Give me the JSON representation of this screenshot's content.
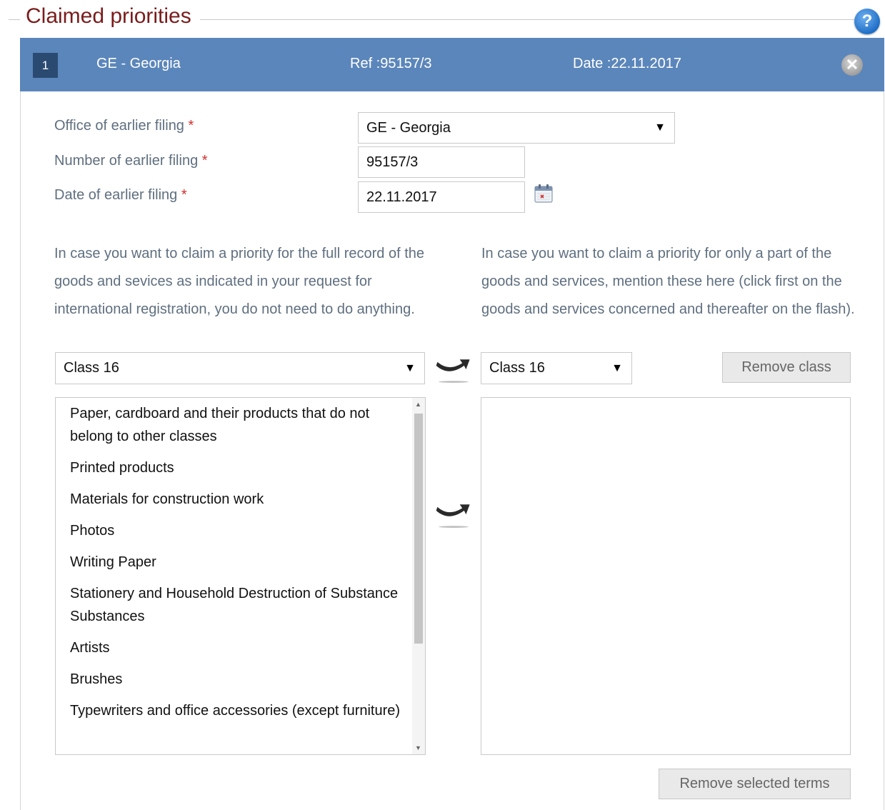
{
  "fieldset": {
    "title": "Claimed priorities",
    "help_glyph": "?"
  },
  "priority_bar": {
    "index": "1",
    "country": "GE - Georgia",
    "ref": "Ref :95157/3",
    "date": "Date :22.11.2017",
    "close_glyph": "✕"
  },
  "form": {
    "office_label": "Office of earlier filing",
    "office_value": "GE - Georgia",
    "number_label": "Number of earlier filing",
    "number_value": "95157/3",
    "date_label": "Date of earlier filing",
    "date_value": "22.11.2017",
    "required_mark": "*"
  },
  "instructions": {
    "left": "In case you want to claim a priority for the full record of the goods and sevices as indicated in your request for international registration, you do not need to do anything.",
    "right": "In case you want to claim a priority for only a part of the goods and services, mention these here (click first on the goods and services concerned and thereafter on the flash)."
  },
  "classes": {
    "left_select": "Class 16",
    "right_select": "Class 16",
    "remove_class": "Remove class",
    "remove_terms": "Remove selected terms",
    "dropdown_glyph": "▼"
  },
  "terms": [
    "Paper, cardboard and their products that do not belong to other classes",
    "Printed products",
    "Materials for construction work",
    "Photos",
    "Writing Paper",
    "Stationery and Household Destruction of Substance Substances",
    "Artists",
    "Brushes",
    "Typewriters and office accessories (except furniture)"
  ],
  "colors": {
    "title": "#7a1c1c",
    "bar": "#5b86bb",
    "bar_index": "#2b4a72",
    "label": "#5f6f7f",
    "required": "#d0302e"
  },
  "icons": {
    "help": "help-icon",
    "close": "close-icon",
    "calendar": "calendar-icon",
    "transfer": "curved-arrow-icon"
  }
}
